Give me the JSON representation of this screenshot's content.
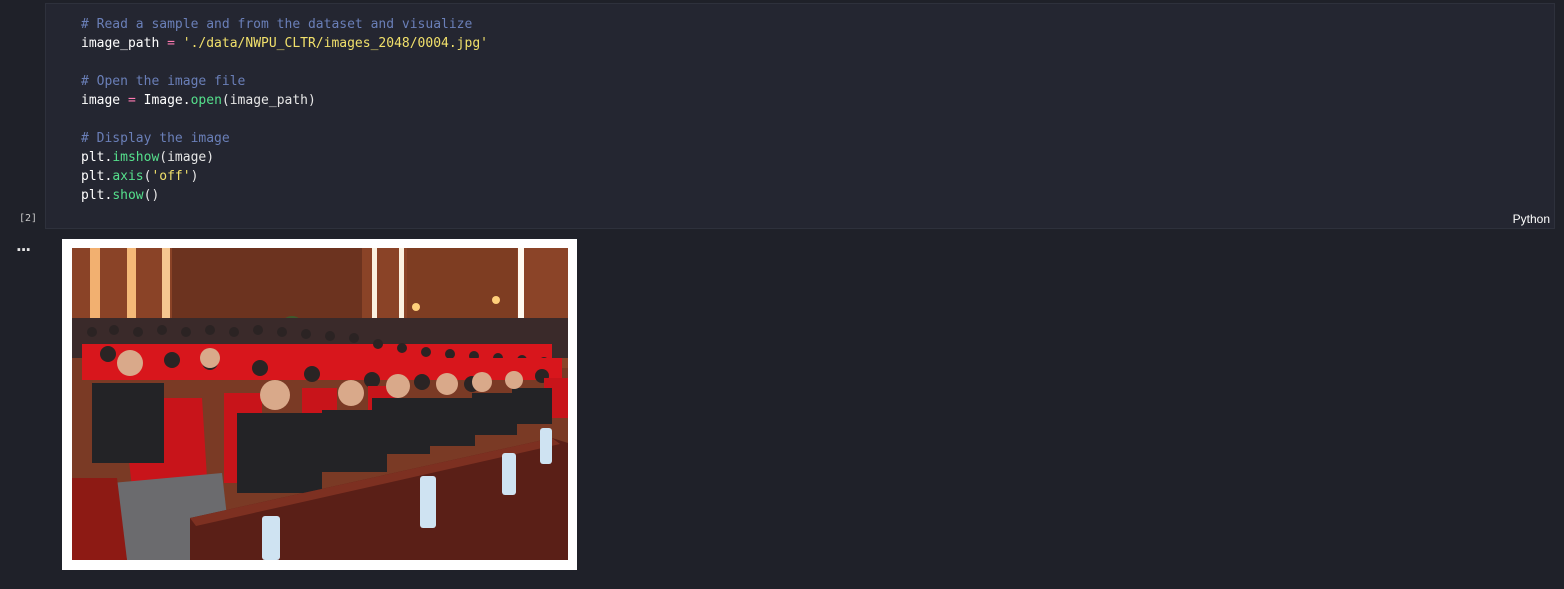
{
  "cell": {
    "execution_count": "[2]",
    "language": "Python",
    "code_lines": [
      [
        {
          "t": "comment",
          "v": "# Read a sample and from the dataset and visualize"
        }
      ],
      [
        {
          "t": "ident",
          "v": "image_path "
        },
        {
          "t": "op",
          "v": "="
        },
        {
          "t": "punct",
          "v": " "
        },
        {
          "t": "string",
          "v": "'./data/NWPU_CLTR/images_2048/0004.jpg'"
        }
      ],
      [],
      [
        {
          "t": "comment",
          "v": "# Open the image file"
        }
      ],
      [
        {
          "t": "ident",
          "v": "image "
        },
        {
          "t": "op",
          "v": "="
        },
        {
          "t": "ident",
          "v": " Image."
        },
        {
          "t": "func",
          "v": "open"
        },
        {
          "t": "punct",
          "v": "(image_path)"
        }
      ],
      [],
      [
        {
          "t": "comment",
          "v": "# Display the image"
        }
      ],
      [
        {
          "t": "ident",
          "v": "plt."
        },
        {
          "t": "func",
          "v": "imshow"
        },
        {
          "t": "punct",
          "v": "(image)"
        }
      ],
      [
        {
          "t": "ident",
          "v": "plt."
        },
        {
          "t": "func",
          "v": "axis"
        },
        {
          "t": "punct",
          "v": "("
        },
        {
          "t": "string",
          "v": "'off'"
        },
        {
          "t": "punct",
          "v": ")"
        }
      ],
      [
        {
          "t": "ident",
          "v": "plt."
        },
        {
          "t": "func",
          "v": "show"
        },
        {
          "t": "punct",
          "v": "()"
        }
      ]
    ]
  },
  "output": {
    "toggle_label": "...",
    "image_subject": "auditorium-audience-photo"
  },
  "colors": {
    "background": "#1f2129",
    "cell_background": "#242631",
    "comment": "#6a7fb8",
    "string": "#f1e06b",
    "function": "#55e08c",
    "operator": "#ff7ab2",
    "seat_red": "#d8161c"
  }
}
